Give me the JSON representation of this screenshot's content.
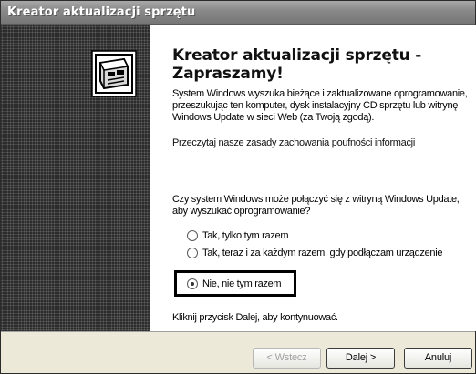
{
  "window": {
    "title": "Kreator aktualizacji sprzętu"
  },
  "side": {
    "icon": "hardware-device-icon"
  },
  "content": {
    "heading_line1": "Kreator aktualizacji sprzętu -",
    "heading_line2": "Zapraszamy!",
    "description": "System Windows wyszuka bieżące i zaktualizowane oprogramowanie, przeszukując ten komputer, dysk instalacyjny CD sprzętu lub witrynę Windows Update w sieci Web (za Twoją zgodą).",
    "privacy_link": "Przeczytaj nasze zasady zachowania poufności informacji",
    "question": "Czy system Windows może połączyć się z witryną Windows Update, aby wyszukać oprogramowanie?",
    "options": [
      {
        "label": "Tak, tylko tym razem",
        "selected": false
      },
      {
        "label": "Tak, teraz i za każdym razem, gdy podłączam urządzenie",
        "selected": false
      },
      {
        "label": "Nie, nie tym razem",
        "selected": true
      }
    ],
    "instruction": "Kliknij przycisk Dalej, aby kontynuować."
  },
  "buttons": {
    "back": "< Wstecz",
    "next": "Dalej >",
    "cancel": "Anuluj"
  }
}
